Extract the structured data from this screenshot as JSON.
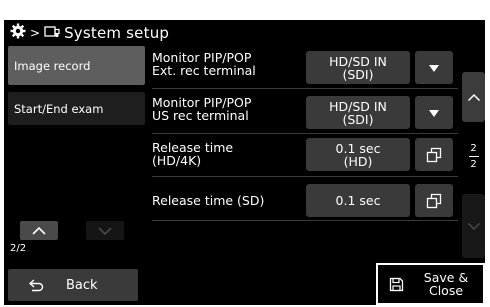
{
  "header": {
    "title": "System setup",
    "separator": ">",
    "icons": [
      "gear-icon",
      "system-icon"
    ]
  },
  "sidebar": {
    "items": [
      {
        "label": "Image record",
        "selected": true
      },
      {
        "label": "Start/End exam",
        "selected": false
      }
    ],
    "page": "2/2"
  },
  "settings": [
    {
      "label": [
        "Monitor PIP/POP",
        "Ext. rec terminal"
      ],
      "value": [
        "HD/SD IN",
        "(SDI)"
      ],
      "control": "dropdown-icon"
    },
    {
      "label": [
        "Monitor PIP/POP",
        "US rec terminal"
      ],
      "value": [
        "HD/SD IN",
        "(SDI)"
      ],
      "control": "dropdown-icon"
    },
    {
      "label": [
        "Release time",
        "(HD/4K)"
      ],
      "value": [
        "0.1 sec",
        "(HD)"
      ],
      "control": "popup-icon"
    },
    {
      "label": [
        "Release time (SD)"
      ],
      "value": [
        "0.1 sec"
      ],
      "control": "popup-icon"
    }
  ],
  "scroll": {
    "page_current": "2",
    "page_total": "2"
  },
  "footer": {
    "back_label": "Back",
    "save_label": [
      "Save &",
      "Close"
    ]
  },
  "colors": {
    "background": "#000000",
    "selected": "#5e5e5e",
    "control": "#3a3a3a"
  }
}
